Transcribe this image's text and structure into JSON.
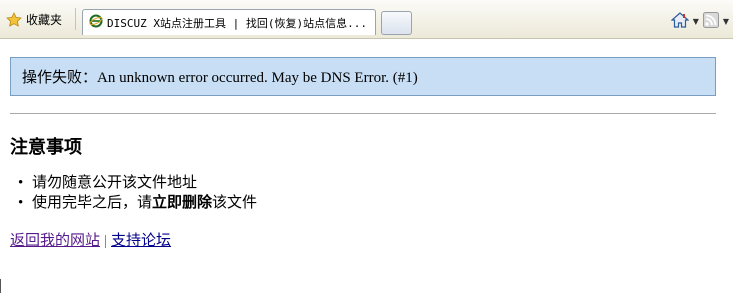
{
  "toolbar": {
    "favorites_label": "收藏夹",
    "tab_title": "DISCUZ X站点注册工具 | 找回(恢复)站点信息...",
    "icons": [
      "star-icon",
      "ie-page-icon",
      "home-icon",
      "rss-icon"
    ]
  },
  "main": {
    "error_text": "操作失败：An unknown error occurred. May be DNS Error. (#1)",
    "notice_title": "注意事项",
    "notice_items": [
      {
        "text": "请勿随意公开该文件地址"
      },
      {
        "before": "使用完毕之后，请",
        "bold": "立即删除",
        "after": "该文件"
      }
    ],
    "links": {
      "back": "返回我的网站",
      "separator": "|",
      "support": "支持论坛"
    }
  },
  "colors": {
    "error_bg": "#c7def5",
    "error_border": "#7a9ec2",
    "visited_link": "#551a8b",
    "link": "#00008b"
  }
}
